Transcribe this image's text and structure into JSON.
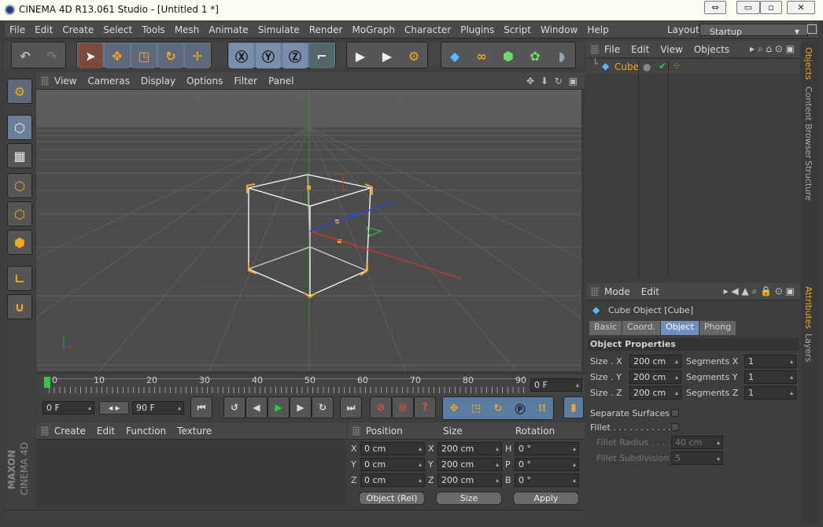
{
  "window": {
    "title": "CINEMA 4D R13.061 Studio - [Untitled 1 *]",
    "btn_resize": "⇔",
    "btn_min": "▭",
    "btn_max": "▫",
    "btn_close": "✕"
  },
  "menu": [
    "File",
    "Edit",
    "Create",
    "Select",
    "Tools",
    "Mesh",
    "Animate",
    "Simulate",
    "Render",
    "MoGraph",
    "Character",
    "Plugins",
    "Script",
    "Window",
    "Help"
  ],
  "layout": {
    "label": "Layout:",
    "value": "Startup"
  },
  "viewport": {
    "menu": [
      "View",
      "Cameras",
      "Display",
      "Options",
      "Filter",
      "Panel"
    ]
  },
  "timeline": {
    "ticks": [
      "0",
      "10",
      "20",
      "30",
      "40",
      "50",
      "60",
      "70",
      "80",
      "90"
    ],
    "current": "0 F",
    "start": "0 F",
    "end": "90 F"
  },
  "objects": {
    "menu": [
      "File",
      "Edit",
      "View",
      "Objects"
    ],
    "items": [
      {
        "name": "Cube"
      }
    ],
    "side_tabs": [
      "Objects",
      "Content Browser",
      "Structure"
    ]
  },
  "attributes": {
    "menu": [
      "Mode",
      "Edit"
    ],
    "title": "Cube Object [Cube]",
    "tabs": [
      "Basic",
      "Coord.",
      "Object",
      "Phong"
    ],
    "active_tab": "Object",
    "section": "Object Properties",
    "size_x_label": "Size . X",
    "size_x": "200 cm",
    "size_y_label": "Size . Y",
    "size_y": "200 cm",
    "size_z_label": "Size . Z",
    "size_z": "200 cm",
    "seg_x_label": "Segments X",
    "seg_x": "1",
    "seg_y_label": "Segments Y",
    "seg_y": "1",
    "seg_z_label": "Segments Z",
    "seg_z": "1",
    "separate_label": "Separate Surfaces",
    "fillet_label": "Fillet . . . . . . . . . . .",
    "fillet_radius_label": "Fillet Radius . . . .",
    "fillet_radius": "40 cm",
    "fillet_sub_label": "Fillet Subdivision",
    "fillet_sub": "5",
    "side_tabs": [
      "Attributes",
      "Layers"
    ]
  },
  "materials": {
    "menu": [
      "Create",
      "Edit",
      "Function",
      "Texture"
    ]
  },
  "coords": {
    "headers": [
      "Position",
      "Size",
      "Rotation"
    ],
    "pos": {
      "x": "0 cm",
      "y": "0 cm",
      "z": "0 cm"
    },
    "size": {
      "x": "200 cm",
      "y": "200 cm",
      "z": "200 cm"
    },
    "rot": {
      "h": "0 °",
      "p": "0 °",
      "b": "0 °"
    },
    "axis_x": "X",
    "axis_y": "Y",
    "axis_z": "Z",
    "axis_h": "H",
    "axis_p": "P",
    "axis_b": "B",
    "mode": "Object (Rel)",
    "size_mode": "Size",
    "apply": "Apply"
  },
  "logo": {
    "brand": "MAXON",
    "product": "CINEMA 4D"
  }
}
